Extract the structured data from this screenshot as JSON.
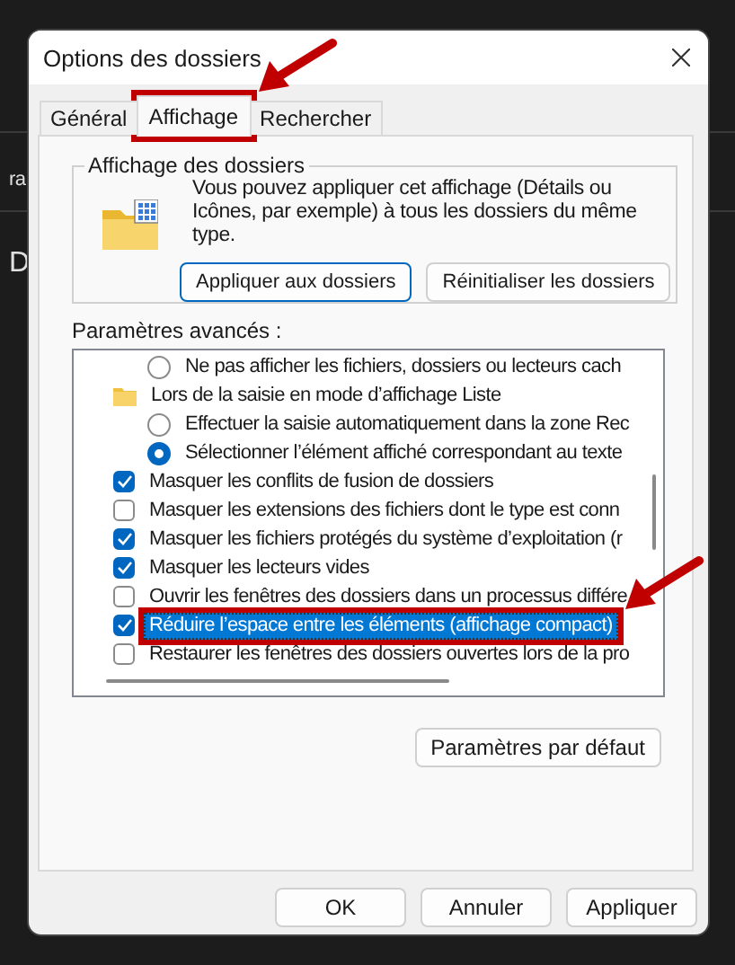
{
  "background_window": {
    "fragment_1": "ra",
    "fragment_2": "D"
  },
  "window": {
    "title": "Options des dossiers"
  },
  "tabs": [
    {
      "label": "Général",
      "selected": false,
      "annotated": false
    },
    {
      "label": "Affichage",
      "selected": true,
      "annotated": true
    },
    {
      "label": "Rechercher",
      "selected": false,
      "annotated": false
    }
  ],
  "folder_view": {
    "heading": "Affichage des dossiers",
    "description": "Vous pouvez appliquer cet affichage (Détails ou Icônes, par exemple) à tous les dossiers du même type.",
    "buttons": [
      {
        "label": "Appliquer aux dossiers",
        "focused": true
      },
      {
        "label": "Réinitialiser les dossiers",
        "focused": false
      }
    ]
  },
  "advanced": {
    "heading": "Paramètres avancés :",
    "items": [
      {
        "kind": "radio",
        "label": "Ne pas afficher les fichiers, dossiers ou lecteurs cach",
        "checked": false,
        "selected": false,
        "annotated": false
      },
      {
        "kind": "folder",
        "label": "Lors de la saisie en mode d’affichage Liste",
        "selected": false,
        "annotated": false
      },
      {
        "kind": "radio",
        "label": "Effectuer la saisie automatiquement dans la zone Rec",
        "checked": false,
        "selected": false,
        "annotated": false
      },
      {
        "kind": "radio",
        "label": "Sélectionner l’élément affiché correspondant au texte",
        "checked": true,
        "selected": false,
        "annotated": false
      },
      {
        "kind": "checkbox",
        "label": "Masquer les conflits de fusion de dossiers",
        "checked": true,
        "selected": false,
        "annotated": false
      },
      {
        "kind": "checkbox",
        "label": "Masquer les extensions des fichiers dont le type est conn",
        "checked": false,
        "selected": false,
        "annotated": false
      },
      {
        "kind": "checkbox",
        "label": "Masquer les fichiers protégés du système d’exploitation (r",
        "checked": true,
        "selected": false,
        "annotated": false
      },
      {
        "kind": "checkbox",
        "label": "Masquer les lecteurs vides",
        "checked": true,
        "selected": false,
        "annotated": false
      },
      {
        "kind": "checkbox",
        "label": "Ouvrir les fenêtres des dossiers dans un processus différe",
        "checked": false,
        "selected": false,
        "annotated": false
      },
      {
        "kind": "checkbox",
        "label": "Réduire l’espace entre les éléments (affichage compact)",
        "checked": true,
        "selected": true,
        "annotated": true
      },
      {
        "kind": "checkbox",
        "label": "Restaurer les fenêtres des dossiers ouvertes lors de la pro",
        "checked": false,
        "selected": false,
        "annotated": false
      }
    ],
    "default_button": "Paramètres par défaut"
  },
  "buttons": [
    "OK",
    "Annuler",
    "Appliquer"
  ]
}
